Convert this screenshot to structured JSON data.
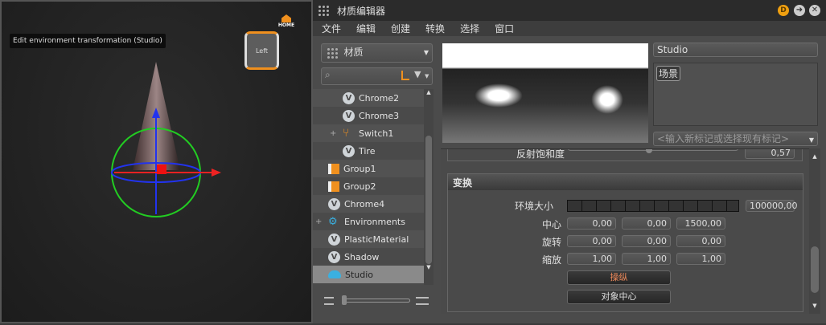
{
  "viewport": {
    "tooltip": "Edit environment transformation (Studio)",
    "viewcube_face": "Left",
    "home_label": "HOME"
  },
  "window": {
    "title": "材质编辑器",
    "icons": [
      "d-badge-icon",
      "arrow-right-icon",
      "close-icon"
    ],
    "badge": "D"
  },
  "menu": [
    "文件",
    "编辑",
    "创建",
    "转换",
    "选择",
    "窗口"
  ],
  "library": {
    "dropdown": "材质",
    "search_placeholder": ""
  },
  "tree": [
    {
      "label": "Chrome2",
      "icon": "material",
      "level": 1
    },
    {
      "label": "Chrome3",
      "icon": "material",
      "level": 1
    },
    {
      "label": "Switch1",
      "icon": "switch",
      "level": 1,
      "expandable": true
    },
    {
      "label": "Tire",
      "icon": "material",
      "level": 1
    },
    {
      "label": "Group1",
      "icon": "group",
      "level": 0
    },
    {
      "label": "Group2",
      "icon": "group",
      "level": 0
    },
    {
      "label": "Chrome4",
      "icon": "material",
      "level": 0
    },
    {
      "label": "Environments",
      "icon": "environments",
      "level": 0,
      "expandable": true
    },
    {
      "label": "PlasticMaterial",
      "icon": "material",
      "level": 0
    },
    {
      "label": "Shadow",
      "icon": "material",
      "level": 0
    },
    {
      "label": "Studio",
      "icon": "environment",
      "level": 0,
      "selected": true
    }
  ],
  "properties": {
    "name": "Studio",
    "tags": [
      "场景"
    ],
    "tag_placeholder": "<输入新标记或选择现有标记>",
    "saturation_label": "反射饱和度",
    "saturation_value": "0,57",
    "section": "变换",
    "env_size_label": "环境大小",
    "env_size": "100000,00",
    "center_label": "中心",
    "center": [
      "0,00",
      "0,00",
      "1500,00"
    ],
    "rotation_label": "旋转",
    "rotation": [
      "0,00",
      "0,00",
      "0,00"
    ],
    "scale_label": "缩放",
    "scale": [
      "1,00",
      "1,00",
      "1,00"
    ],
    "manipulate_button": "操纵",
    "object_center_button": "对象中心"
  },
  "colors": {
    "accent": "#f0901e",
    "manipulate_text": "#f08a5a"
  }
}
